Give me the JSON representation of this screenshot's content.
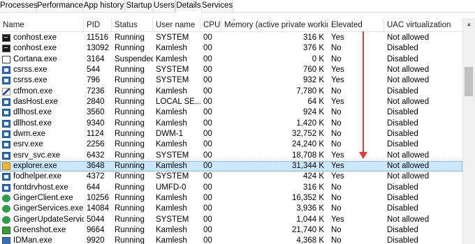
{
  "tabs": [
    {
      "label": "Processes",
      "active": false
    },
    {
      "label": "Performance",
      "active": false
    },
    {
      "label": "App history",
      "active": false
    },
    {
      "label": "Startup",
      "active": false
    },
    {
      "label": "Users",
      "active": false
    },
    {
      "label": "Details",
      "active": true
    },
    {
      "label": "Services",
      "active": false
    }
  ],
  "columns": {
    "name": "Name",
    "pid": "PID",
    "status": "Status",
    "user": "User name",
    "cpu": "CPU",
    "memory": "Memory (active private working...",
    "elevated": "Elevated",
    "uac": "UAC virtualization"
  },
  "rows": [
    {
      "icon": "console-icon",
      "name": "conhost.exe",
      "pid": "11516",
      "status": "Running",
      "user": "SYSTEM",
      "cpu": "00",
      "memory": "316 K",
      "elevated": "Yes",
      "uac": "Not allowed"
    },
    {
      "icon": "console-icon",
      "name": "conhost.exe",
      "pid": "13092",
      "status": "Running",
      "user": "Kamlesh",
      "cpu": "00",
      "memory": "376 K",
      "elevated": "No",
      "uac": "Disabled"
    },
    {
      "icon": "cortana-icon",
      "name": "Cortana.exe",
      "pid": "3164",
      "status": "Suspended",
      "user": "Kamlesh",
      "cpu": "00",
      "memory": "0 K",
      "elevated": "No",
      "uac": "Disabled"
    },
    {
      "icon": "app-icon",
      "name": "csrss.exe",
      "pid": "544",
      "status": "Running",
      "user": "SYSTEM",
      "cpu": "00",
      "memory": "760 K",
      "elevated": "Yes",
      "uac": "Not allowed"
    },
    {
      "icon": "app-icon",
      "name": "csrss.exe",
      "pid": "796",
      "status": "Running",
      "user": "SYSTEM",
      "cpu": "00",
      "memory": "932 K",
      "elevated": "Yes",
      "uac": "Not allowed"
    },
    {
      "icon": "pen-icon",
      "name": "ctfmon.exe",
      "pid": "7236",
      "status": "Running",
      "user": "Kamlesh",
      "cpu": "00",
      "memory": "7,780 K",
      "elevated": "No",
      "uac": "Disabled"
    },
    {
      "icon": "app-icon",
      "name": "dasHost.exe",
      "pid": "2840",
      "status": "Running",
      "user": "LOCAL SE...",
      "cpu": "00",
      "memory": "64 K",
      "elevated": "Yes",
      "uac": "Not allowed"
    },
    {
      "icon": "app-icon",
      "name": "dllhost.exe",
      "pid": "3560",
      "status": "Running",
      "user": "Kamlesh",
      "cpu": "00",
      "memory": "924 K",
      "elevated": "No",
      "uac": "Disabled"
    },
    {
      "icon": "app-icon",
      "name": "dllhost.exe",
      "pid": "9340",
      "status": "Running",
      "user": "Kamlesh",
      "cpu": "00",
      "memory": "1,420 K",
      "elevated": "No",
      "uac": "Disabled"
    },
    {
      "icon": "app-icon",
      "name": "dwm.exe",
      "pid": "1124",
      "status": "Running",
      "user": "DWM-1",
      "cpu": "00",
      "memory": "32,752 K",
      "elevated": "No",
      "uac": "Disabled"
    },
    {
      "icon": "app-icon",
      "name": "esrv.exe",
      "pid": "2256",
      "status": "Running",
      "user": "Kamlesh",
      "cpu": "00",
      "memory": "24,240 K",
      "elevated": "No",
      "uac": "Disabled"
    },
    {
      "icon": "app-icon",
      "name": "esrv_svc.exe",
      "pid": "6432",
      "status": "Running",
      "user": "SYSTEM",
      "cpu": "00",
      "memory": "18,708 K",
      "elevated": "Yes",
      "uac": "Not allowed"
    },
    {
      "icon": "folder-icon",
      "name": "explorer.exe",
      "pid": "3648",
      "status": "Running",
      "user": "Kamlesh",
      "cpu": "00",
      "memory": "31,344 K",
      "elevated": "Yes",
      "uac": "Not allowed",
      "selected": true
    },
    {
      "icon": "app-icon",
      "name": "fodhelper.exe",
      "pid": "4372",
      "status": "Running",
      "user": "SYSTEM",
      "cpu": "00",
      "memory": "424 K",
      "elevated": "Yes",
      "uac": "Not allowed"
    },
    {
      "icon": "app-icon",
      "name": "fontdrvhost.exe",
      "pid": "644",
      "status": "Running",
      "user": "UMFD-0",
      "cpu": "00",
      "memory": "316 K",
      "elevated": "No",
      "uac": "Disabled"
    },
    {
      "icon": "ginger-icon",
      "name": "GingerClient.exe",
      "pid": "10256",
      "status": "Running",
      "user": "Kamlesh",
      "cpu": "00",
      "memory": "16,352 K",
      "elevated": "No",
      "uac": "Disabled"
    },
    {
      "icon": "ginger-icon",
      "name": "GingerServices.exe",
      "pid": "14084",
      "status": "Running",
      "user": "Kamlesh",
      "cpu": "00",
      "memory": "3,936 K",
      "elevated": "No",
      "uac": "Disabled"
    },
    {
      "icon": "ginger-icon",
      "name": "GingerUpdateService...",
      "pid": "5044",
      "status": "Running",
      "user": "SYSTEM",
      "cpu": "00",
      "memory": "1,044 K",
      "elevated": "Yes",
      "uac": "Not allowed"
    },
    {
      "icon": "greenshot-icon",
      "name": "Greenshot.exe",
      "pid": "9664",
      "status": "Running",
      "user": "Kamlesh",
      "cpu": "00",
      "memory": "21,740 K",
      "elevated": "No",
      "uac": "Disabled"
    },
    {
      "icon": "idman-icon",
      "name": "IDMan.exe",
      "pid": "9920",
      "status": "Running",
      "user": "Kamlesh",
      "cpu": "00",
      "memory": "4,368 K",
      "elevated": "No",
      "uac": "Disabled"
    }
  ],
  "colors": {
    "selected_row": "#cce8ff",
    "annotation_arrow": "#e53935"
  }
}
